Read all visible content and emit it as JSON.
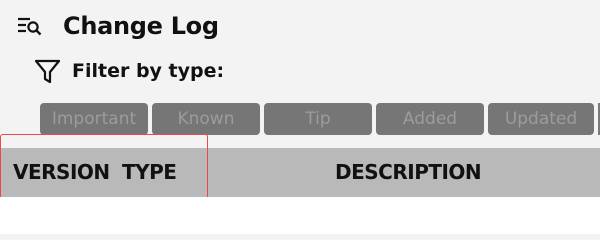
{
  "header": {
    "title": "Change Log",
    "title_icon": "search-list-icon"
  },
  "filter": {
    "label": "Filter by type:",
    "icon": "funnel-icon",
    "chips": [
      {
        "label": "Important"
      },
      {
        "label": "Known"
      },
      {
        "label": "Tip"
      },
      {
        "label": "Added"
      },
      {
        "label": "Updated"
      }
    ]
  },
  "table": {
    "columns": [
      "VERSION",
      "TYPE",
      "DESCRIPTION"
    ]
  },
  "colors": {
    "chip_bg": "#767676",
    "chip_text": "#9c9c9c",
    "header_bg": "#b9b9b9",
    "highlight": "#e44b4b"
  }
}
